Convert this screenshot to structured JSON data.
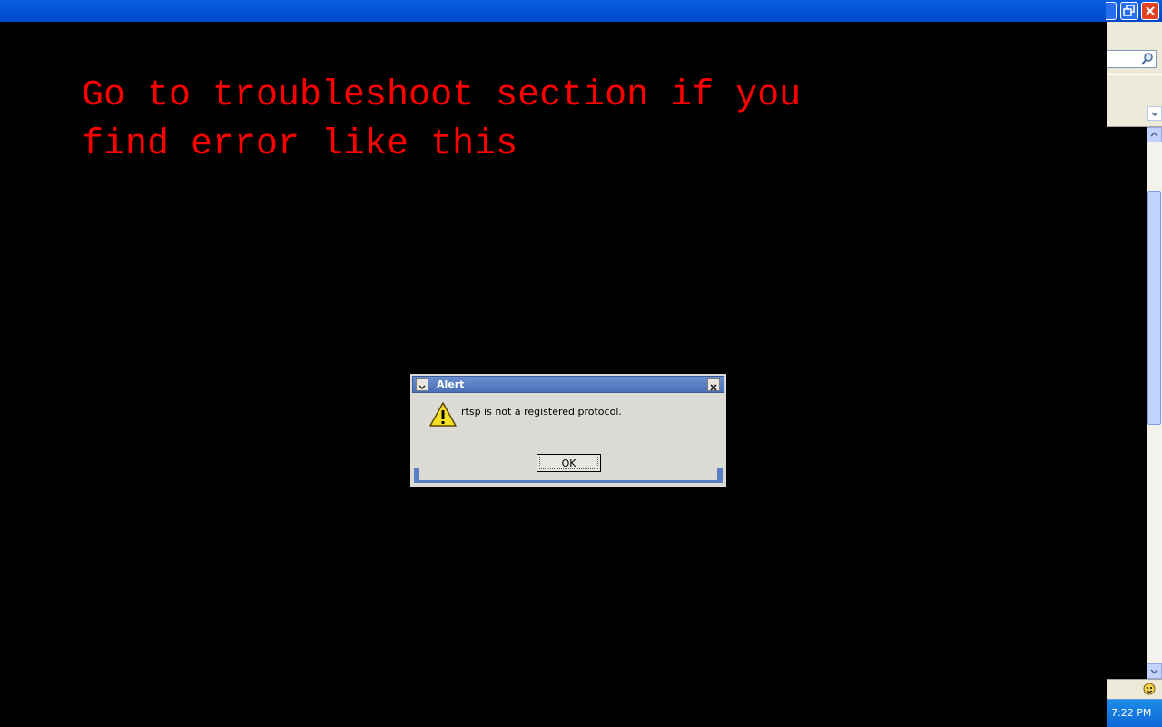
{
  "overlay": {
    "caption": "Go to troubleshoot section if you\nfind error like this"
  },
  "dialog": {
    "title": "Alert",
    "message": "rtsp is not a registered protocol.",
    "ok_label": "OK",
    "icon": "warning-icon"
  },
  "taskbar": {
    "clock": "7:22 PM"
  },
  "colors": {
    "caption": "#ff0000",
    "background": "#000000",
    "xp_title_blue": "#0a5fe3"
  }
}
